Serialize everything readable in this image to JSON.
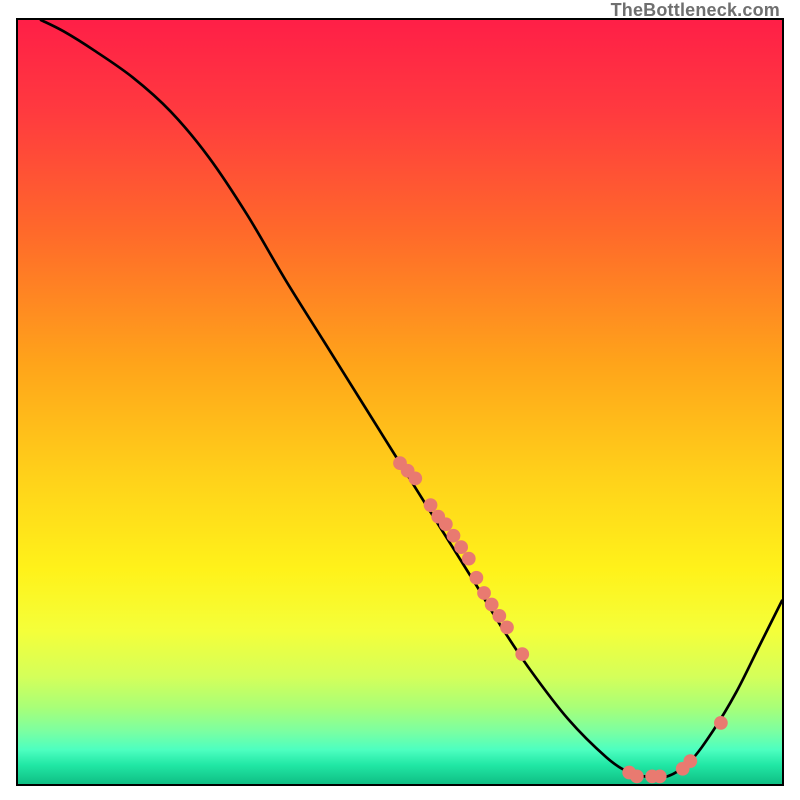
{
  "watermark": "TheBottleneck.com",
  "chart_data": {
    "type": "line",
    "title": "",
    "xlabel": "",
    "ylabel": "",
    "xlim": [
      0,
      100
    ],
    "ylim": [
      0,
      100
    ],
    "curve": {
      "name": "bottleneck-curve",
      "x": [
        3,
        6,
        10,
        15,
        20,
        25,
        30,
        35,
        40,
        45,
        50,
        55,
        60,
        63,
        67,
        72,
        77,
        80,
        82,
        85,
        88,
        91,
        94,
        97,
        100
      ],
      "y": [
        100,
        98.5,
        96,
        92.5,
        88,
        82,
        74.5,
        66,
        58,
        50,
        42,
        34,
        26,
        21,
        15,
        8.5,
        3.5,
        1.5,
        1,
        1,
        3,
        7,
        12,
        18,
        24
      ]
    },
    "scatter": {
      "name": "highlighted-points",
      "x": [
        50,
        51,
        52,
        54,
        55,
        56,
        57,
        58,
        59,
        60,
        61,
        62,
        63,
        64,
        66,
        80,
        81,
        83,
        84,
        87,
        88,
        92
      ],
      "y": [
        42,
        41,
        40,
        36.5,
        35,
        34,
        32.5,
        31,
        29.5,
        27,
        25,
        23.5,
        22,
        20.5,
        17,
        1.5,
        1,
        1,
        1,
        2,
        3,
        8
      ]
    },
    "gradient_bands": [
      {
        "stop": 0.0,
        "color": "#ff1f47"
      },
      {
        "stop": 0.12,
        "color": "#ff3a3f"
      },
      {
        "stop": 0.28,
        "color": "#ff6a2a"
      },
      {
        "stop": 0.45,
        "color": "#ffa41a"
      },
      {
        "stop": 0.6,
        "color": "#ffd21a"
      },
      {
        "stop": 0.72,
        "color": "#fff21a"
      },
      {
        "stop": 0.8,
        "color": "#f4ff3a"
      },
      {
        "stop": 0.86,
        "color": "#d4ff5a"
      },
      {
        "stop": 0.9,
        "color": "#a8ff78"
      },
      {
        "stop": 0.93,
        "color": "#7dffa0"
      },
      {
        "stop": 0.955,
        "color": "#4dffc0"
      },
      {
        "stop": 0.975,
        "color": "#21e7a5"
      },
      {
        "stop": 1.0,
        "color": "#0fbf84"
      }
    ]
  }
}
